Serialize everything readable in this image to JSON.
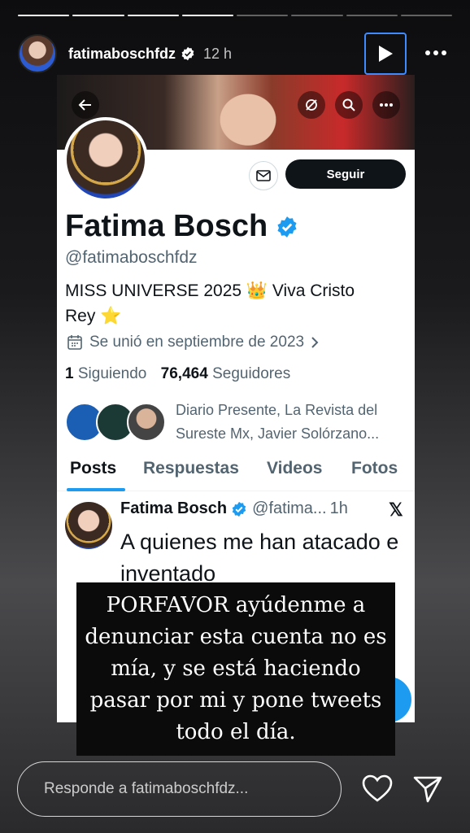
{
  "story": {
    "username": "fatimaboschfdz",
    "time": "12 h",
    "segments_total": 8,
    "segments_done": 4
  },
  "profile": {
    "name": "Fatima Bosch",
    "handle": "@fatimaboschfdz",
    "bio_line1": "MISS UNIVERSE 2025 👑 Viva Cristo",
    "bio_line2": "Rey ⭐",
    "joined": "Se unió en septiembre de 2023",
    "following_count": "1",
    "following_label": "Siguiendo",
    "followers_count": "76,464",
    "followers_label": "Seguidores",
    "followed_by_line1": "Diario Presente, La Revista del",
    "followed_by_line2": "Sureste Mx, Javier Solórzano...",
    "follow_label": "Seguir"
  },
  "tabs": [
    "Posts",
    "Respuestas",
    "Videos",
    "Fotos"
  ],
  "tweet": {
    "author": "Fatima Bosch",
    "handle": "@fatima...",
    "time": "1h",
    "text": "A quienes me han atacado e inventado"
  },
  "overlay": {
    "text": "PORFAVOR ayúdenme a denunciar esta cuenta no es mía, y se está haciendo pasar por mi y pone tweets todo el día."
  },
  "reply": {
    "placeholder": "Responde a fatimaboschfdz..."
  },
  "colors": {
    "accent": "#1d9bf0",
    "focus_border": "#3d8bff"
  }
}
